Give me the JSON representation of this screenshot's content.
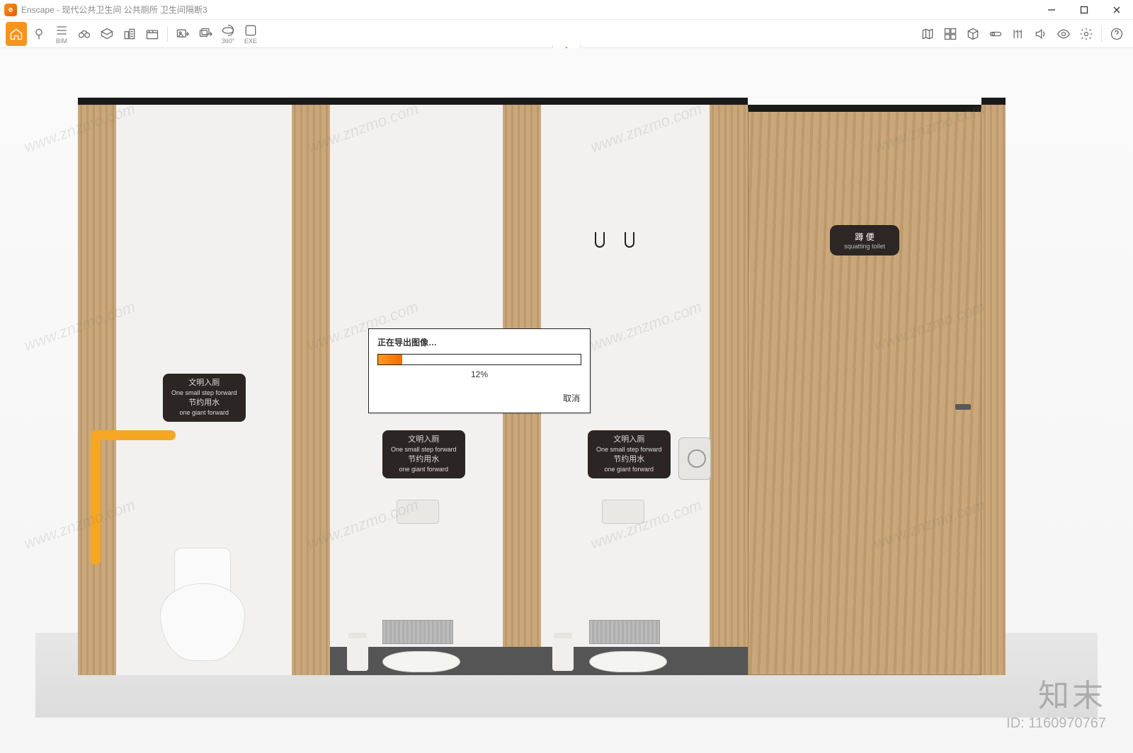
{
  "window": {
    "app_name": "Enscape",
    "title": "Enscape - 现代公共卫生间 公共厕所 卫生间隔断3"
  },
  "toolbar_left": {
    "home_icon": "home-icon",
    "bim_label": "BIM",
    "items": [
      "pin-icon",
      "stripes-icon",
      "binoculars-icon",
      "perspective-icon",
      "buildings-icon",
      "clapper-icon"
    ],
    "export_group": [
      "export-image-icon",
      "export-video-icon",
      "export-360-icon",
      "export-exe-icon"
    ],
    "export_labels": {
      "p360": "360°",
      "exe": "EXE"
    }
  },
  "toolbar_right": {
    "items": [
      "map-icon",
      "asset-library-icon",
      "box-icon",
      "compare-icon",
      "views-icon",
      "sound-icon",
      "eye-icon",
      "gear-icon",
      "help-icon"
    ]
  },
  "dialog": {
    "message": "正在导出图像…",
    "percent_label": "12%",
    "percent_value": 12,
    "cancel": "取消"
  },
  "scene_signs": {
    "stall_sign_line1": "文明入厕",
    "stall_sign_line1_en": "One small step forward",
    "stall_sign_line2": "节约用水",
    "stall_sign_line2_en": "one giant forward",
    "door_sign_cn": "蹲 便",
    "door_sign_en": "squatting toilet"
  },
  "watermark": {
    "text": "www.znzmo.com",
    "brand_cn": "知末",
    "id_label": "ID: 1160970767"
  }
}
